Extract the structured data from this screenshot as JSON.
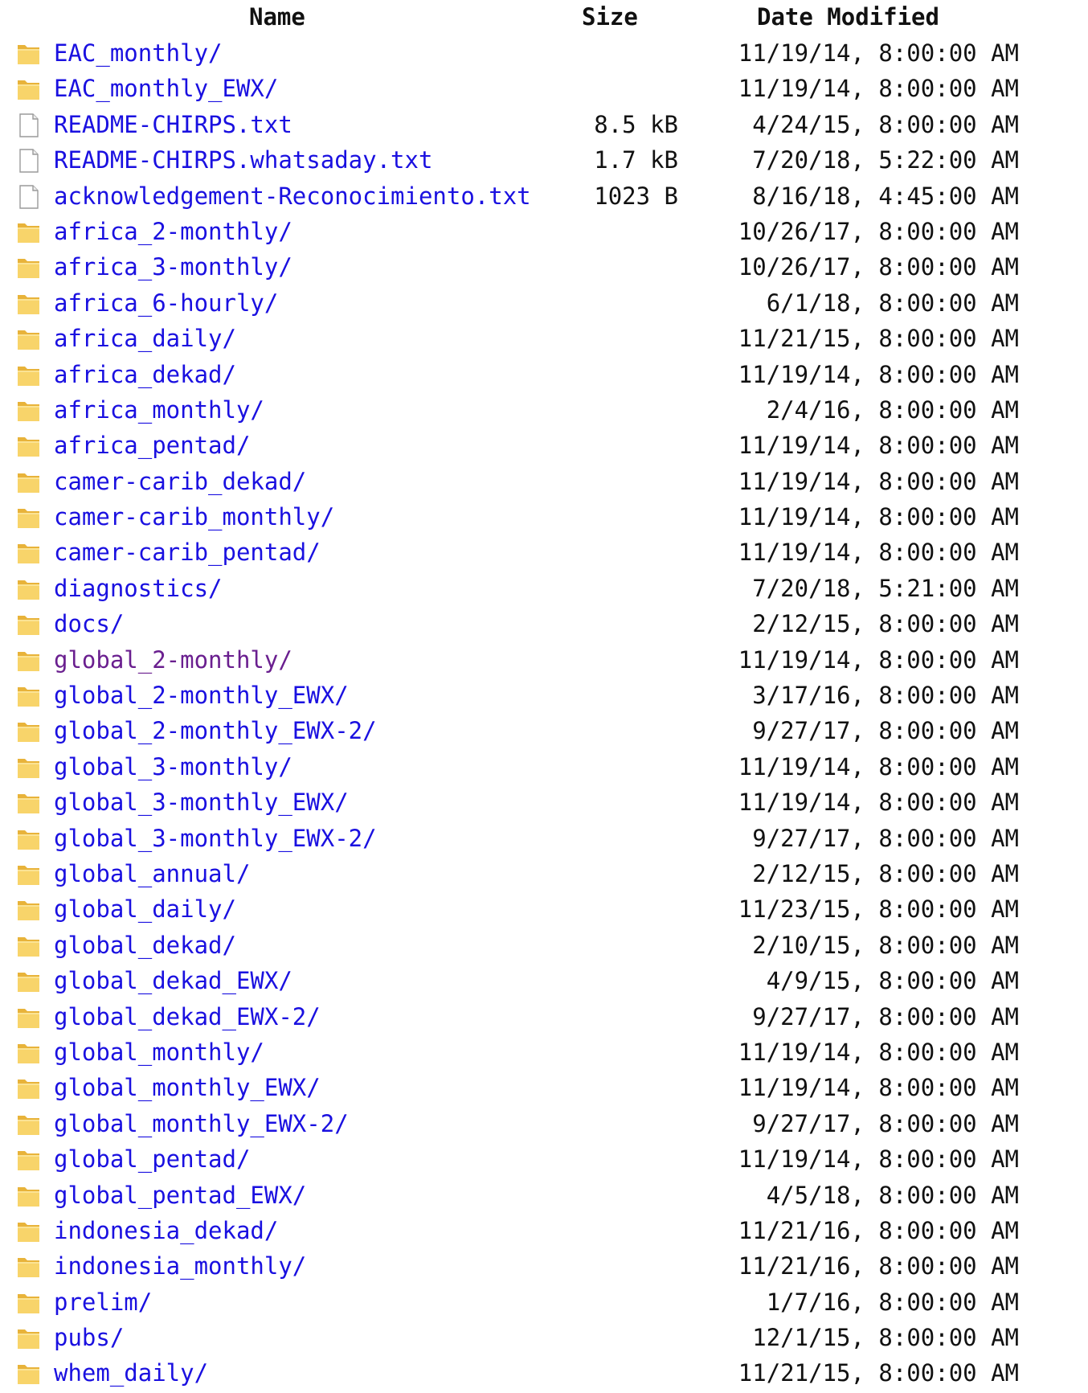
{
  "columns": {
    "name": "Name",
    "size": "Size",
    "date": "Date Modified"
  },
  "colors": {
    "link": "#1a10e0",
    "visited_link": "#6a1f8f",
    "folder_icon": "#f5c542",
    "text": "#111111"
  },
  "entries": [
    {
      "type": "folder",
      "icon": "folder-icon",
      "name": "EAC_monthly/",
      "size": "",
      "date": "11/19/14, 8:00:00 AM"
    },
    {
      "type": "folder",
      "icon": "folder-icon",
      "name": "EAC_monthly_EWX/",
      "size": "",
      "date": "11/19/14, 8:00:00 AM"
    },
    {
      "type": "file",
      "icon": "file-icon",
      "name": "README-CHIRPS.txt",
      "size": "8.5 kB",
      "date": "4/24/15, 8:00:00 AM"
    },
    {
      "type": "file",
      "icon": "file-icon",
      "name": "README-CHIRPS.whatsaday.txt",
      "size": "1.7 kB",
      "date": "7/20/18, 5:22:00 AM"
    },
    {
      "type": "file",
      "icon": "file-icon",
      "name": "acknowledgement-Reconocimiento.txt",
      "size": "1023 B",
      "date": "8/16/18, 4:45:00 AM"
    },
    {
      "type": "folder",
      "icon": "folder-icon",
      "name": "africa_2-monthly/",
      "size": "",
      "date": "10/26/17, 8:00:00 AM"
    },
    {
      "type": "folder",
      "icon": "folder-icon",
      "name": "africa_3-monthly/",
      "size": "",
      "date": "10/26/17, 8:00:00 AM"
    },
    {
      "type": "folder",
      "icon": "folder-icon",
      "name": "africa_6-hourly/",
      "size": "",
      "date": "6/1/18, 8:00:00 AM"
    },
    {
      "type": "folder",
      "icon": "folder-icon",
      "name": "africa_daily/",
      "size": "",
      "date": "11/21/15, 8:00:00 AM"
    },
    {
      "type": "folder",
      "icon": "folder-icon",
      "name": "africa_dekad/",
      "size": "",
      "date": "11/19/14, 8:00:00 AM"
    },
    {
      "type": "folder",
      "icon": "folder-icon",
      "name": "africa_monthly/",
      "size": "",
      "date": "2/4/16, 8:00:00 AM"
    },
    {
      "type": "folder",
      "icon": "folder-icon",
      "name": "africa_pentad/",
      "size": "",
      "date": "11/19/14, 8:00:00 AM"
    },
    {
      "type": "folder",
      "icon": "folder-icon",
      "name": "camer-carib_dekad/",
      "size": "",
      "date": "11/19/14, 8:00:00 AM"
    },
    {
      "type": "folder",
      "icon": "folder-icon",
      "name": "camer-carib_monthly/",
      "size": "",
      "date": "11/19/14, 8:00:00 AM"
    },
    {
      "type": "folder",
      "icon": "folder-icon",
      "name": "camer-carib_pentad/",
      "size": "",
      "date": "11/19/14, 8:00:00 AM"
    },
    {
      "type": "folder",
      "icon": "folder-icon",
      "name": "diagnostics/",
      "size": "",
      "date": "7/20/18, 5:21:00 AM"
    },
    {
      "type": "folder",
      "icon": "folder-icon",
      "name": "docs/",
      "size": "",
      "date": "2/12/15, 8:00:00 AM"
    },
    {
      "type": "folder",
      "icon": "folder-icon",
      "name": "global_2-monthly/",
      "size": "",
      "date": "11/19/14, 8:00:00 AM",
      "visited": true
    },
    {
      "type": "folder",
      "icon": "folder-icon",
      "name": "global_2-monthly_EWX/",
      "size": "",
      "date": "3/17/16, 8:00:00 AM"
    },
    {
      "type": "folder",
      "icon": "folder-icon",
      "name": "global_2-monthly_EWX-2/",
      "size": "",
      "date": "9/27/17, 8:00:00 AM"
    },
    {
      "type": "folder",
      "icon": "folder-icon",
      "name": "global_3-monthly/",
      "size": "",
      "date": "11/19/14, 8:00:00 AM"
    },
    {
      "type": "folder",
      "icon": "folder-icon",
      "name": "global_3-monthly_EWX/",
      "size": "",
      "date": "11/19/14, 8:00:00 AM"
    },
    {
      "type": "folder",
      "icon": "folder-icon",
      "name": "global_3-monthly_EWX-2/",
      "size": "",
      "date": "9/27/17, 8:00:00 AM"
    },
    {
      "type": "folder",
      "icon": "folder-icon",
      "name": "global_annual/",
      "size": "",
      "date": "2/12/15, 8:00:00 AM"
    },
    {
      "type": "folder",
      "icon": "folder-icon",
      "name": "global_daily/",
      "size": "",
      "date": "11/23/15, 8:00:00 AM"
    },
    {
      "type": "folder",
      "icon": "folder-icon",
      "name": "global_dekad/",
      "size": "",
      "date": "2/10/15, 8:00:00 AM"
    },
    {
      "type": "folder",
      "icon": "folder-icon",
      "name": "global_dekad_EWX/",
      "size": "",
      "date": "4/9/15, 8:00:00 AM"
    },
    {
      "type": "folder",
      "icon": "folder-icon",
      "name": "global_dekad_EWX-2/",
      "size": "",
      "date": "9/27/17, 8:00:00 AM"
    },
    {
      "type": "folder",
      "icon": "folder-icon",
      "name": "global_monthly/",
      "size": "",
      "date": "11/19/14, 8:00:00 AM"
    },
    {
      "type": "folder",
      "icon": "folder-icon",
      "name": "global_monthly_EWX/",
      "size": "",
      "date": "11/19/14, 8:00:00 AM"
    },
    {
      "type": "folder",
      "icon": "folder-icon",
      "name": "global_monthly_EWX-2/",
      "size": "",
      "date": "9/27/17, 8:00:00 AM"
    },
    {
      "type": "folder",
      "icon": "folder-icon",
      "name": "global_pentad/",
      "size": "",
      "date": "11/19/14, 8:00:00 AM"
    },
    {
      "type": "folder",
      "icon": "folder-icon",
      "name": "global_pentad_EWX/",
      "size": "",
      "date": "4/5/18, 8:00:00 AM"
    },
    {
      "type": "folder",
      "icon": "folder-icon",
      "name": "indonesia_dekad/",
      "size": "",
      "date": "11/21/16, 8:00:00 AM"
    },
    {
      "type": "folder",
      "icon": "folder-icon",
      "name": "indonesia_monthly/",
      "size": "",
      "date": "11/21/16, 8:00:00 AM"
    },
    {
      "type": "folder",
      "icon": "folder-icon",
      "name": "prelim/",
      "size": "",
      "date": "1/7/16, 8:00:00 AM"
    },
    {
      "type": "folder",
      "icon": "folder-icon",
      "name": "pubs/",
      "size": "",
      "date": "12/1/15, 8:00:00 AM"
    },
    {
      "type": "folder",
      "icon": "folder-icon",
      "name": "whem_daily/",
      "size": "",
      "date": "11/21/15, 8:00:00 AM"
    }
  ]
}
